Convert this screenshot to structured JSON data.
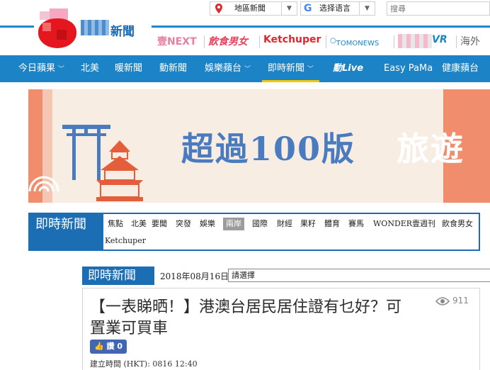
{
  "header": {
    "logo_text": "新聞",
    "region_label": "地區新聞",
    "language_label": "选择语言",
    "search_placeholder": "搜尋",
    "brands": {
      "next": "壹NEXT",
      "food": "飲食男女",
      "ketchuper": "Ketchuper",
      "tomonews": "TOMONEWS",
      "vr": "VR",
      "overseas": "海外"
    }
  },
  "nav": {
    "items": [
      {
        "label": "今日蘋果",
        "chevron": true
      },
      {
        "label": "北美",
        "chevron": false
      },
      {
        "label": "暖新聞",
        "chevron": false
      },
      {
        "label": "動新聞",
        "chevron": false
      },
      {
        "label": "娛樂蘋台",
        "chevron": true
      },
      {
        "label": "即時新聞",
        "chevron": true,
        "active": true
      },
      {
        "label": "動Live",
        "chevron": false
      },
      {
        "label": "Easy PaMa",
        "chevron": false
      },
      {
        "label": "健康蘋台",
        "chevron": false
      }
    ]
  },
  "banner": {
    "headline": "超過100版",
    "headline2": "旅遊",
    "colors": {
      "accent": "#f08d6c",
      "text": "#4a7bbf"
    }
  },
  "category_bar": {
    "title": "即時新聞",
    "row1": [
      "焦點",
      "北美",
      "要聞",
      "突發",
      "娛樂",
      "兩岸",
      "國際",
      "財經",
      "果籽",
      "體育",
      "賽馬",
      "WONDER",
      "壹週刊",
      "飲食男女"
    ],
    "row2": [
      "Ketchuper"
    ],
    "selected": "兩岸"
  },
  "date_row": {
    "title": "即時新聞",
    "date": "2018年08月16日",
    "select_value": "請選擇"
  },
  "article": {
    "title": "【一表睇晒！】港澳台居民居住證有乜好？可置業可買車",
    "views": "911",
    "like_label": "讚 0",
    "created": "建立時間 (HKT): 0816 12:40"
  },
  "colors": {
    "primary_blue": "#1c83c6",
    "dark_blue": "#1c6eb4",
    "active_underline": "#f7c600",
    "selected_category": "#9c9c9c"
  }
}
